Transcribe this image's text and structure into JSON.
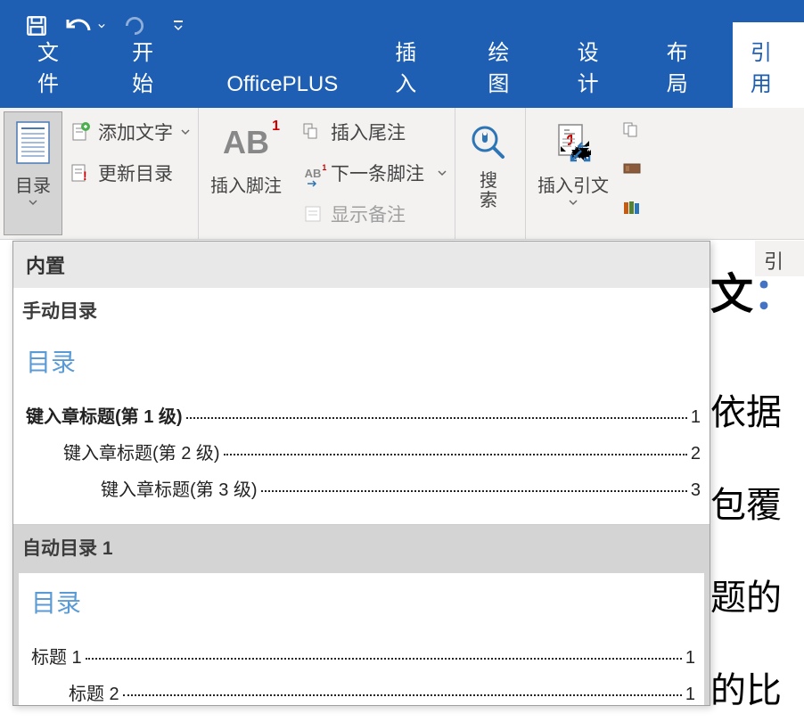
{
  "qat": {
    "save": "save-icon",
    "undo": "undo-icon",
    "redo": "redo-icon"
  },
  "tabs": [
    {
      "id": "file",
      "label": "文件",
      "active": false
    },
    {
      "id": "home",
      "label": "开始",
      "active": false
    },
    {
      "id": "officeplus",
      "label": "OfficePLUS",
      "active": false
    },
    {
      "id": "insert",
      "label": "插入",
      "active": false
    },
    {
      "id": "draw",
      "label": "绘图",
      "active": false
    },
    {
      "id": "design",
      "label": "设计",
      "active": false
    },
    {
      "id": "layout",
      "label": "布局",
      "active": false
    },
    {
      "id": "references",
      "label": "引用",
      "active": true
    }
  ],
  "ribbon": {
    "toc_group": {
      "toc_button": "目录",
      "add_text": "添加文字",
      "update_toc": "更新目录"
    },
    "footnote_group": {
      "insert_footnote": "插入脚注",
      "insert_endnote": "插入尾注",
      "next_footnote": "下一条脚注",
      "show_notes": "显示备注"
    },
    "search_group": {
      "search": "搜索"
    },
    "citation_group": {
      "insert_citation": "插入引文",
      "group_name": "引"
    }
  },
  "toc_dropdown": {
    "header": "内置",
    "manual": {
      "section_label": "手动目录",
      "title": "目录",
      "lines": [
        {
          "level": 1,
          "text": "键入章标题(第 1 级)",
          "page": "1",
          "bold": true
        },
        {
          "level": 2,
          "text": "键入章标题(第 2 级)",
          "page": "2",
          "bold": false
        },
        {
          "level": 3,
          "text": "键入章标题(第 3 级)",
          "page": "3",
          "bold": false
        }
      ]
    },
    "auto1": {
      "section_label": "自动目录 1",
      "title": "目录",
      "lines": [
        {
          "level": 1,
          "text": "标题 1",
          "page": "1",
          "bold": false
        },
        {
          "level": 2,
          "text": "标题 2",
          "page": "1",
          "bold": false
        }
      ]
    }
  },
  "document": {
    "key_label": "文",
    "colon": "：",
    "body_fragments": [
      "依据",
      "包覆",
      "题的",
      "的比"
    ]
  }
}
